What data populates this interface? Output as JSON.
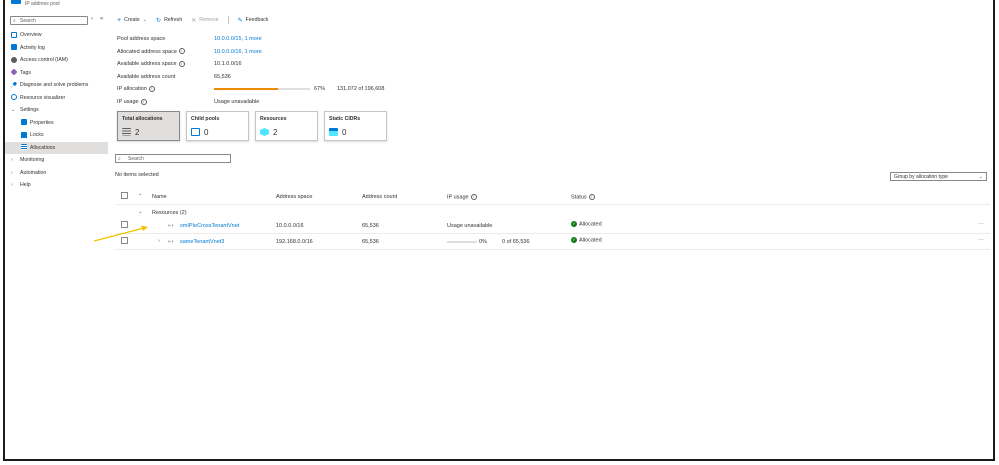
{
  "window": {
    "subtitle": "IP address pool"
  },
  "sidebar": {
    "search_placeholder": "Search",
    "items": [
      {
        "label": "Overview",
        "icon": "overview-icon",
        "color": "#0078d4"
      },
      {
        "label": "Activity log",
        "icon": "activity-log-icon",
        "color": "#0078d4"
      },
      {
        "label": "Access control (IAM)",
        "icon": "iam-icon",
        "color": "#605e5c"
      },
      {
        "label": "Tags",
        "icon": "tag-icon",
        "color": "#8764b8"
      },
      {
        "label": "Diagnose and solve problems",
        "icon": "wrench-icon",
        "color": "#0078d4"
      },
      {
        "label": "Resource visualizer",
        "icon": "visualizer-icon",
        "color": "#0078d4"
      },
      {
        "label": "Settings",
        "icon": "chevron-down-icon"
      },
      {
        "label": "Properties",
        "icon": "properties-icon",
        "color": "#0078d4"
      },
      {
        "label": "Locks",
        "icon": "lock-icon",
        "color": "#0078d4"
      },
      {
        "label": "Allocations",
        "icon": "allocations-icon",
        "color": "#0078d4"
      },
      {
        "label": "Monitoring",
        "icon": "chevron-right-icon"
      },
      {
        "label": "Automation",
        "icon": "chevron-right-icon"
      },
      {
        "label": "Help",
        "icon": "chevron-right-icon"
      }
    ]
  },
  "toolbar": {
    "create": "Create",
    "refresh": "Refresh",
    "remove": "Remove",
    "feedback": "Feedback"
  },
  "properties": {
    "pool_address_space_label": "Pool address space",
    "pool_address_space_value": "10.0.0.0/15, 1 more",
    "allocated_address_space_label": "Allocated address space",
    "allocated_address_space_value": "10.0.0.0/16, 1 more",
    "available_address_space_label": "Available address space",
    "available_address_space_value": "10.1.0.0/16",
    "available_address_count_label": "Available address count",
    "available_address_count_value": "65,536",
    "ip_allocation_label": "IP allocation",
    "ip_allocation_percent": "67%",
    "ip_allocation_fraction": 0.67,
    "ip_allocation_count": "131,072 of 196,608",
    "ip_usage_label": "IP usage",
    "ip_usage_value": "Usage unavailable"
  },
  "cards": [
    {
      "title": "Total allocations",
      "value": "2",
      "icon": "list-icon"
    },
    {
      "title": "Child pools",
      "value": "0",
      "icon": "pool-icon"
    },
    {
      "title": "Resources",
      "value": "2",
      "icon": "cube-icon"
    },
    {
      "title": "Static CIDRs",
      "value": "0",
      "icon": "cidr-icon"
    }
  ],
  "grid": {
    "search_placeholder": "Search",
    "selection_text": "No items selected",
    "group_by": "Group by allocation type",
    "columns": {
      "name": "Name",
      "address_space": "Address space",
      "address_count": "Address count",
      "ip_usage": "IP usage",
      "status": "Status"
    },
    "group_label": "Resources (2)",
    "rows": [
      {
        "name": "smIPIeCrossTenantVnet",
        "address_space": "10.0.0.0/16",
        "address_count": "65,536",
        "ip_usage": "Usage unavailable",
        "status": "Allocated"
      },
      {
        "name": "sameTenantVnet3",
        "address_space": "192.168.0.0/16",
        "address_count": "65,536",
        "ip_usage_percent": "0%",
        "ip_usage_count": "0 of 65,536",
        "ip_usage_fraction": 0,
        "status": "Allocated"
      }
    ]
  },
  "colors": {
    "accent": "#0078d4",
    "allocation_bar": "#ed8b00",
    "allocated_status": "#107c10",
    "arrow": "#f2c200"
  }
}
